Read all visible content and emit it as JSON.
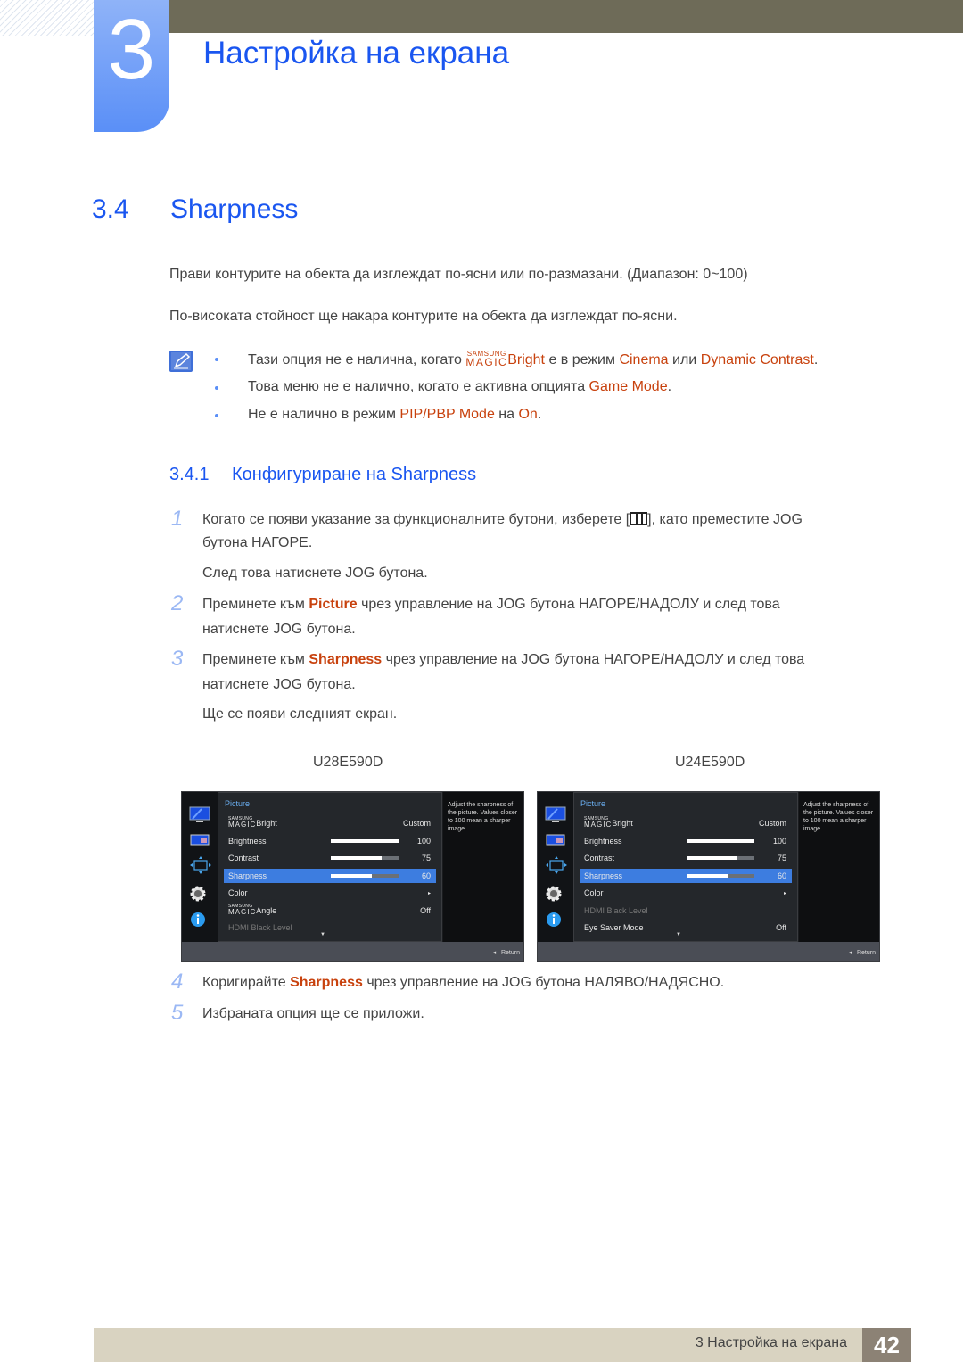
{
  "chapter": {
    "number": "3",
    "title": "Настройка на екрана"
  },
  "section": {
    "number": "3.4",
    "title": "Sharpness"
  },
  "intro": [
    "Прави контурите на обекта да изглеждат по-ясни или по-размазани. (Диапазон: 0~100)",
    "По-високата стойност ще накара контурите на обекта да изглеждат по-ясни."
  ],
  "notes": {
    "icon": "note-pencil-icon",
    "items": [
      {
        "pre": "Тази опция не е налична, когато ",
        "magic_top": "SAMSUNG",
        "magic_bottom": "MAGIC",
        "magic_word": "Bright",
        "mid": " е в режим ",
        "hl1": "Cinema",
        "mid2": " или ",
        "hl2": "Dynamic Contrast",
        "post": "."
      },
      {
        "pre": "Това меню не е налично, когато е активна опцията ",
        "hl1": "Game Mode",
        "post": "."
      },
      {
        "pre": "Не е налично в режим ",
        "hl1": "PIP/PBP Mode",
        "mid": " на ",
        "hl2": "On",
        "post": "."
      }
    ]
  },
  "subsection": {
    "number": "3.4.1",
    "title": "Конфигуриране на Sharpness"
  },
  "steps": [
    {
      "n": "1",
      "line1_pre": "Когато се появи указание за функционалните бутони, изберете [",
      "icon": "menu-grid-icon",
      "line1_post": "], като преместите JOG",
      "line2": "бутона НАГОРЕ.",
      "line3": "След това натиснете JOG бутона."
    },
    {
      "n": "2",
      "pre": "Преминете към ",
      "hl": "Picture",
      "post": " чрез управление на JOG бутона НАГОРЕ/НАДОЛУ и след това",
      "line2": "натиснете JOG бутона."
    },
    {
      "n": "3",
      "pre": "Преминете към ",
      "hl": "Sharpness",
      "post": " чрез управление на JOG бутона НАГОРЕ/НАДОЛУ и след това",
      "line2": "натиснете JOG бутона.",
      "line3": "Ще се появи следният екран."
    },
    {
      "n": "4",
      "pre": "Коригирайте ",
      "hl": "Sharpness",
      "post": " чрез управление на JOG бутона НАЛЯВО/НАДЯСНО."
    },
    {
      "n": "5",
      "text": "Избраната опция ще се приложи."
    }
  ],
  "osd_screens": [
    {
      "model": "U28E590D",
      "menu_title": "Picture",
      "rows": [
        {
          "label": "Bright",
          "magic": true,
          "value": "Custom"
        },
        {
          "label": "Brightness",
          "value": "100",
          "bar": 100
        },
        {
          "label": "Contrast",
          "value": "75",
          "bar": 75
        },
        {
          "label": "Sharpness",
          "value": "60",
          "bar": 60,
          "selected": true
        },
        {
          "label": "Color",
          "value": "▸"
        },
        {
          "label": "Angle",
          "magic": true,
          "value": "Off"
        },
        {
          "label": "HDMI Black Level",
          "value": "",
          "disabled": true
        }
      ],
      "help": "Adjust the sharpness of the picture. Values closer to 100 mean a sharper image.",
      "return_label": "Return"
    },
    {
      "model": "U24E590D",
      "menu_title": "Picture",
      "rows": [
        {
          "label": "Bright",
          "magic": true,
          "value": "Custom"
        },
        {
          "label": "Brightness",
          "value": "100",
          "bar": 100
        },
        {
          "label": "Contrast",
          "value": "75",
          "bar": 75
        },
        {
          "label": "Sharpness",
          "value": "60",
          "bar": 60,
          "selected": true
        },
        {
          "label": "Color",
          "value": "▸"
        },
        {
          "label": "HDMI Black Level",
          "value": "",
          "disabled": true
        },
        {
          "label": "Eye Saver Mode",
          "value": "Off"
        }
      ],
      "help": "Adjust the sharpness of the picture. Values closer to 100 mean a sharper image.",
      "return_label": "Return"
    }
  ],
  "osd_common": {
    "magic_top": "SAMSUNG",
    "magic_bottom": "MAGIC",
    "side_icons": [
      "monitor-icon",
      "pip-icon",
      "resize-arrows-icon",
      "gear-icon",
      "info-icon"
    ]
  },
  "footer": {
    "label": "3 Настройка на екрана",
    "page": "42"
  },
  "colors": {
    "accent_blue": "#1a56f0",
    "highlight": "#c8420e",
    "footer_bg": "#d9d3c1",
    "page_box": "#8c8275",
    "top_bar": "#6e6b58"
  }
}
